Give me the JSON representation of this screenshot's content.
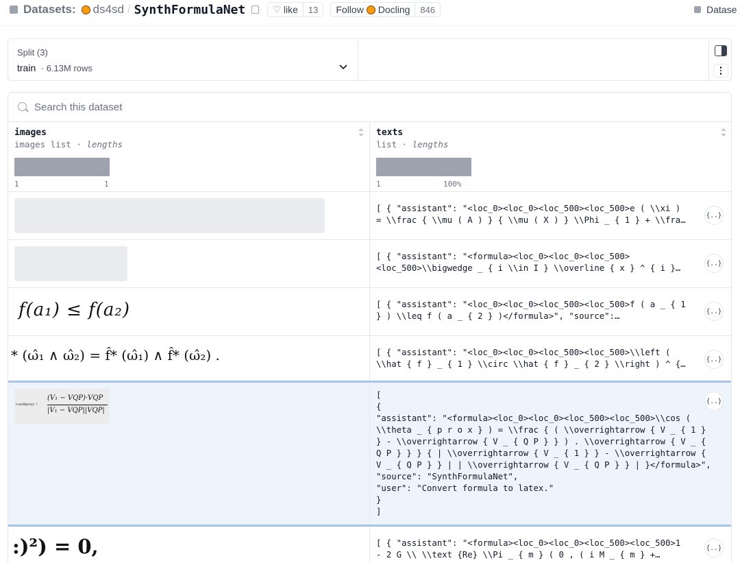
{
  "header": {
    "section_label": "Datasets:",
    "org": "ds4sd",
    "separator": "/",
    "repo": "SynthFormulaNet",
    "like_label": "like",
    "like_count": "13",
    "follow_label": "Follow",
    "follow_org": "Docling",
    "follow_count": "846",
    "right_label": "Datase"
  },
  "split": {
    "title": "Split (3)",
    "name": "train",
    "dot": "·",
    "rows": "6.13M rows"
  },
  "search": {
    "placeholder": "Search this dataset"
  },
  "columns": [
    {
      "name": "images",
      "type": "images list",
      "dot": " · ",
      "extra": "lengths",
      "hist_min": "1",
      "hist_max": "1"
    },
    {
      "name": "texts",
      "type": "list",
      "dot": " · ",
      "extra": "lengths",
      "hist_min": "1",
      "hist_max": "100%"
    }
  ],
  "rows": [
    {
      "text": "[ { \"assistant\": \"<loc_0><loc_0><loc_500><loc_500>e ( \\\\xi )\n= \\\\frac { \\\\mu ( A ) } { \\\\mu ( X ) } \\\\Phi _ { 1 } + \\\\fra…",
      "json_label": "{..}"
    },
    {
      "text": "[ { \"assistant\": \"<formula><loc_0><loc_0><loc_500>\n<loc_500>\\\\bigwedge _ { i \\\\in I } \\\\overline { x } ^ { i }…",
      "json_label": "{..}"
    },
    {
      "text": "[ { \"assistant\": \"<loc_0><loc_0><loc_500><loc_500>f ( a _ { 1\n} ) \\\\leq f ( a _ { 2 } )</formula>\", \"source\":…",
      "json_label": "{..}"
    },
    {
      "text": "[ { \"assistant\": \"<loc_0><loc_0><loc_500><loc_500>\\\\left (\n\\\\hat { f } _ { 1 } \\\\circ \\\\hat { f } _ { 2 } \\\\right ) ^ {…",
      "json_label": "{..}"
    },
    {
      "text": "[\n{\n\"assistant\": \"<formula><loc_0><loc_0><loc_500><loc_500>\\\\cos (\n\\\\theta _ { p r o x } ) = \\\\frac { ( \\\\overrightarrow { V _ { 1 }\n} - \\\\overrightarrow { V _ { Q P } } ) . \\\\overrightarrow { V _ {\nQ P } } } { | \\\\overrightarrow { V _ { 1 } } - \\\\overrightarrow {\nV _ { Q P } } | | \\\\overrightarrow { V _ { Q P } } | }</formula>\",\n\"source\": \"SynthFormulaNet\",\n\"user\": \"Convert formula to latex.\"\n}\n]",
      "json_label": "{..}"
    },
    {
      "text": "[ { \"assistant\": \"<formula><loc_0><loc_0><loc_500><loc_500>1\n- 2 G \\\\ \\\\text {Re} \\\\Pi _ { m } ( 0 , ( i M _ { m } +…",
      "json_label": "{..}"
    }
  ],
  "formula_images": {
    "handwritten": "f(a₁) ≤ f(a₂)",
    "hat_formula": "* (ω̂₁ ∧ ω̂₂) = f̂* (ω̂₁) ∧ f̂* (ω̂₂) .",
    "cos_label": "cos(θprox) =",
    "cos_num": "(V₁ − VQP)·VQP",
    "cos_den": "|V₁ − VQP||VQP|",
    "last_formula": ":)²) = 0,"
  }
}
